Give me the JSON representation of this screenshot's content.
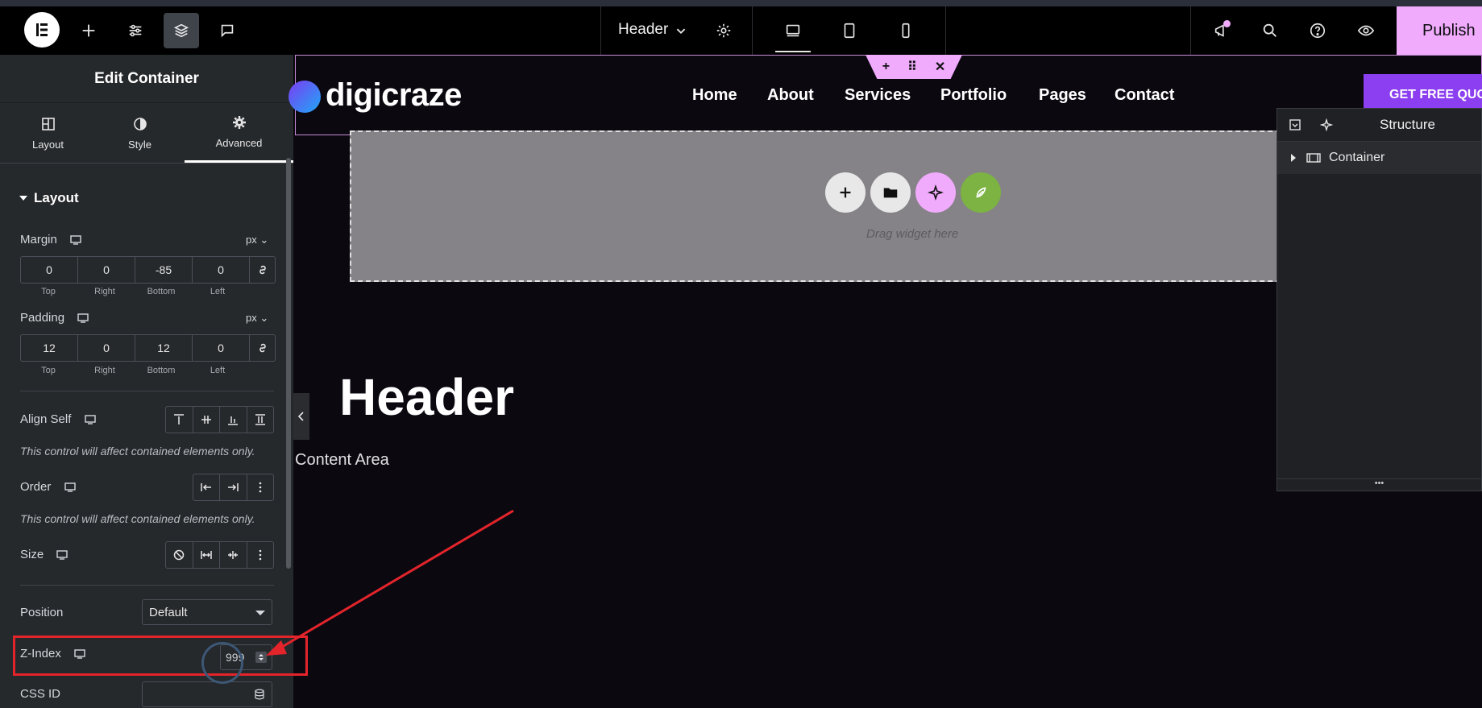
{
  "topbar": {
    "document_title": "Header",
    "publish_label": "Publish"
  },
  "panel": {
    "title": "Edit Container",
    "tabs": [
      {
        "label": "Layout"
      },
      {
        "label": "Style"
      },
      {
        "label": "Advanced"
      }
    ],
    "section_title": "Layout",
    "margin": {
      "label": "Margin",
      "unit": "px",
      "values": [
        "0",
        "0",
        "-85",
        "0"
      ],
      "sides": [
        "Top",
        "Right",
        "Bottom",
        "Left"
      ]
    },
    "padding": {
      "label": "Padding",
      "unit": "px",
      "values": [
        "12",
        "0",
        "12",
        "0"
      ],
      "sides": [
        "Top",
        "Right",
        "Bottom",
        "Left"
      ]
    },
    "align_self": {
      "label": "Align Self",
      "note": "This control will affect contained elements only."
    },
    "order": {
      "label": "Order",
      "note": "This control will affect contained elements only."
    },
    "size": {
      "label": "Size"
    },
    "position": {
      "label": "Position",
      "value": "Default"
    },
    "z_index": {
      "label": "Z-Index",
      "value": "999"
    },
    "css_id": {
      "label": "CSS ID",
      "value": ""
    }
  },
  "site": {
    "logo_text": "digicraze",
    "nav": [
      "Home",
      "About",
      "Services",
      "Portfolio",
      "Pages",
      "Contact"
    ],
    "cta_label": "GET FREE QUOTE",
    "dropzone_text": "Drag widget here",
    "heading": "Header",
    "content_text": "Content Area"
  },
  "structure": {
    "title": "Structure",
    "items": [
      {
        "label": "Container"
      }
    ]
  },
  "colors": {
    "accent_pink": "#f0abfc",
    "annotation_red": "#e3242b",
    "cta_purple": "#8b3ff0",
    "ai_button_green": "#7cb342"
  }
}
